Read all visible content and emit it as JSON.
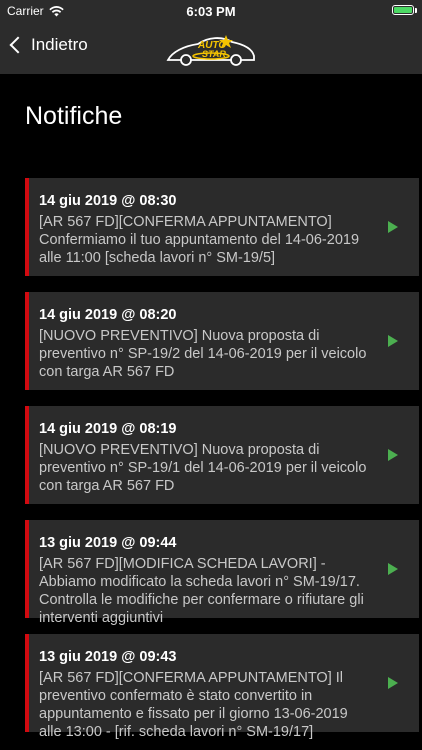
{
  "status_bar": {
    "carrier": "Carrier",
    "time": "6:03 PM"
  },
  "nav": {
    "back_label": "Indietro",
    "logo_text_top": "AUTO",
    "logo_text_bottom": "STAR"
  },
  "page": {
    "title": "Notifiche"
  },
  "notifications": [
    {
      "date": "14 giu 2019 @ 08:30",
      "message": "[AR 567 FD][CONFERMA APPUNTAMENTO] Confermiamo il tuo appuntamento del 14-06-2019 alle 11:00 [scheda lavori n° SM-19/5]"
    },
    {
      "date": "14 giu 2019 @ 08:20",
      "message": "[NUOVO PREVENTIVO] Nuova proposta di preventivo n° SP-19/2 del 14-06-2019 per il veicolo con targa AR 567 FD"
    },
    {
      "date": "14 giu 2019 @ 08:19",
      "message": "[NUOVO PREVENTIVO] Nuova proposta di preventivo n° SP-19/1 del 14-06-2019 per il veicolo con targa AR 567 FD"
    },
    {
      "date": "13 giu 2019 @ 09:44",
      "message": "[AR 567 FD][MODIFICA SCHEDA LAVORI] - Abbiamo modificato la scheda lavori n° SM-19/17. Controlla le modifiche per confermare o rifiutare gli interventi aggiuntivi"
    },
    {
      "date": "13 giu 2019 @ 09:43",
      "message": "[AR 567 FD][CONFERMA APPUNTAMENTO] Il preventivo confermato è stato convertito in appuntamento e fissato per il giorno 13-06-2019 alle 13:00 - [rif. scheda lavori n° SM-19/17]"
    }
  ],
  "colors": {
    "accent_red": "#d10a10",
    "play_green": "#4caf50",
    "battery_green": "#4cd964",
    "card_bg": "#2b2b2b",
    "bar_bg": "#2c2c2c"
  },
  "icons": {
    "wifi": "wifi-icon",
    "battery": "battery-icon",
    "back": "chevron-left-icon",
    "open": "play-icon"
  }
}
